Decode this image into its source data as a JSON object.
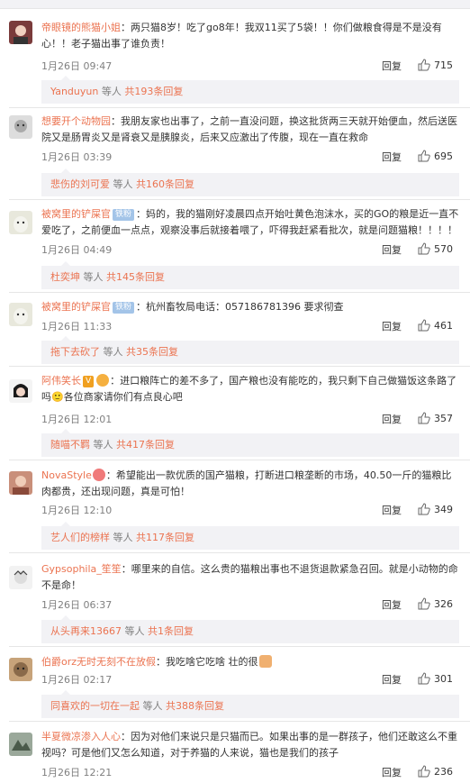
{
  "top_partial": "…",
  "comments": [
    {
      "username": "帝眼镜的熊猫小姐",
      "badge": "",
      "emoji": "",
      "text": "：两只猫8岁！吃了go8年！我双11买了5袋！！你们做粮食得是不是没有心！！老子猫出事了谁负责！",
      "time": "1月26日 09:47",
      "reply_label": "回复",
      "likes": "715",
      "sub_user": "Yanduyun",
      "sub_mid": "等人",
      "sub_count": "共193条回复",
      "avatar_color": "#7a3b3b"
    },
    {
      "username": "想要开个动物园",
      "badge": "",
      "emoji": "",
      "text": "：我朋友家也出事了，之前一直没问题，换这批货两三天就开始便血，然后送医院又是肠胃炎又是肾衰又是胰腺炎，后来又应激出了传腹，现在一直在救命",
      "time": "1月26日 03:39",
      "reply_label": "回复",
      "likes": "695",
      "sub_user": "悲伤的刘可爱",
      "sub_mid": "等人",
      "sub_count": "共160条回复",
      "avatar_color": "#a7a7a7"
    },
    {
      "username": "被窝里的铲屎官",
      "badge": "铁粉",
      "emoji": "",
      "text": "：妈的，我的猫刚好凌晨四点开始吐黄色泡沫水，买的GO的粮是近一直不爱吃了，之前便血一点点，观察没事后就接着喂了，吓得我赶紧看批次，就是问题猫粮！！！！",
      "time": "1月26日 04:49",
      "reply_label": "回复",
      "likes": "570",
      "sub_user": "杜奕坤",
      "sub_mid": "等人",
      "sub_count": "共145条回复",
      "avatar_color": "#d8d8cc"
    },
    {
      "username": "被窝里的铲屎官",
      "badge": "铁粉",
      "emoji": "",
      "text": "：杭州畜牧局电话：057186781396 要求彻查",
      "time": "1月26日 11:33",
      "reply_label": "回复",
      "likes": "461",
      "sub_user": "拖下去砍了",
      "sub_mid": "等人",
      "sub_count": "共35条回复",
      "avatar_color": "#d8d8cc"
    },
    {
      "username": "阿伟笑长",
      "badge": "V",
      "emoji": "",
      "text": "：进口粮阵亡的差不多了，国产粮也没有能吃的，我只剩下自己做猫饭这条路了吗🙂各位商家请你们有点良心吧",
      "time": "1月26日 12:01",
      "reply_label": "回复",
      "likes": "357",
      "sub_user": "随喵不羁",
      "sub_mid": "等人",
      "sub_count": "共417条回复",
      "avatar_color": "#2b2b2b"
    },
    {
      "username": "NovaStyle",
      "badge": "",
      "emoji": "",
      "text": "：希望能出一款优质的国产猫粮，打断进口粮垄断的市场，40.50一斤的猫粮比肉都贵，还出现问题，真是可怕！",
      "time": "1月26日 12:10",
      "reply_label": "回复",
      "likes": "349",
      "sub_user": "艺人们的榜样",
      "sub_mid": "等人",
      "sub_count": "共117条回复",
      "avatar_color": "#c98f7a"
    },
    {
      "username": "Gypsophila_笙笙",
      "badge": "",
      "emoji": "",
      "text": "：哪里来的自信。这么贵的猫粮出事也不退货退款紧急召回。就是小动物的命不是命！",
      "time": "1月26日 06:37",
      "reply_label": "回复",
      "likes": "326",
      "sub_user": "从头再来13667",
      "sub_mid": "等人",
      "sub_count": "共1条回复",
      "avatar_color": "#e2e2e2"
    },
    {
      "username": "伯爵orz无时无刻不在放假",
      "badge": "",
      "emoji": "",
      "text": "：我吃啥它吃啥 壮的很",
      "time": "1月26日 02:17",
      "reply_label": "回复",
      "likes": "301",
      "sub_user": "同喜欢的一切在一起",
      "sub_mid": "等人",
      "sub_count": "共388条回复",
      "avatar_color": "#8a6a4a"
    },
    {
      "username": "半夏微凉渗入人心",
      "badge": "",
      "emoji": "",
      "text": "：因为对他们来说只是只猫而已。如果出事的是一群孩子，他们还敢这么不重视吗？可是他们又怎么知道，对于养猫的人来说，猫也是我们的孩子",
      "time": "1月26日 12:21",
      "reply_label": "回复",
      "likes": "236",
      "sub_user": "",
      "sub_mid": "",
      "sub_count": "",
      "avatar_color": "#6a7a6a"
    }
  ]
}
